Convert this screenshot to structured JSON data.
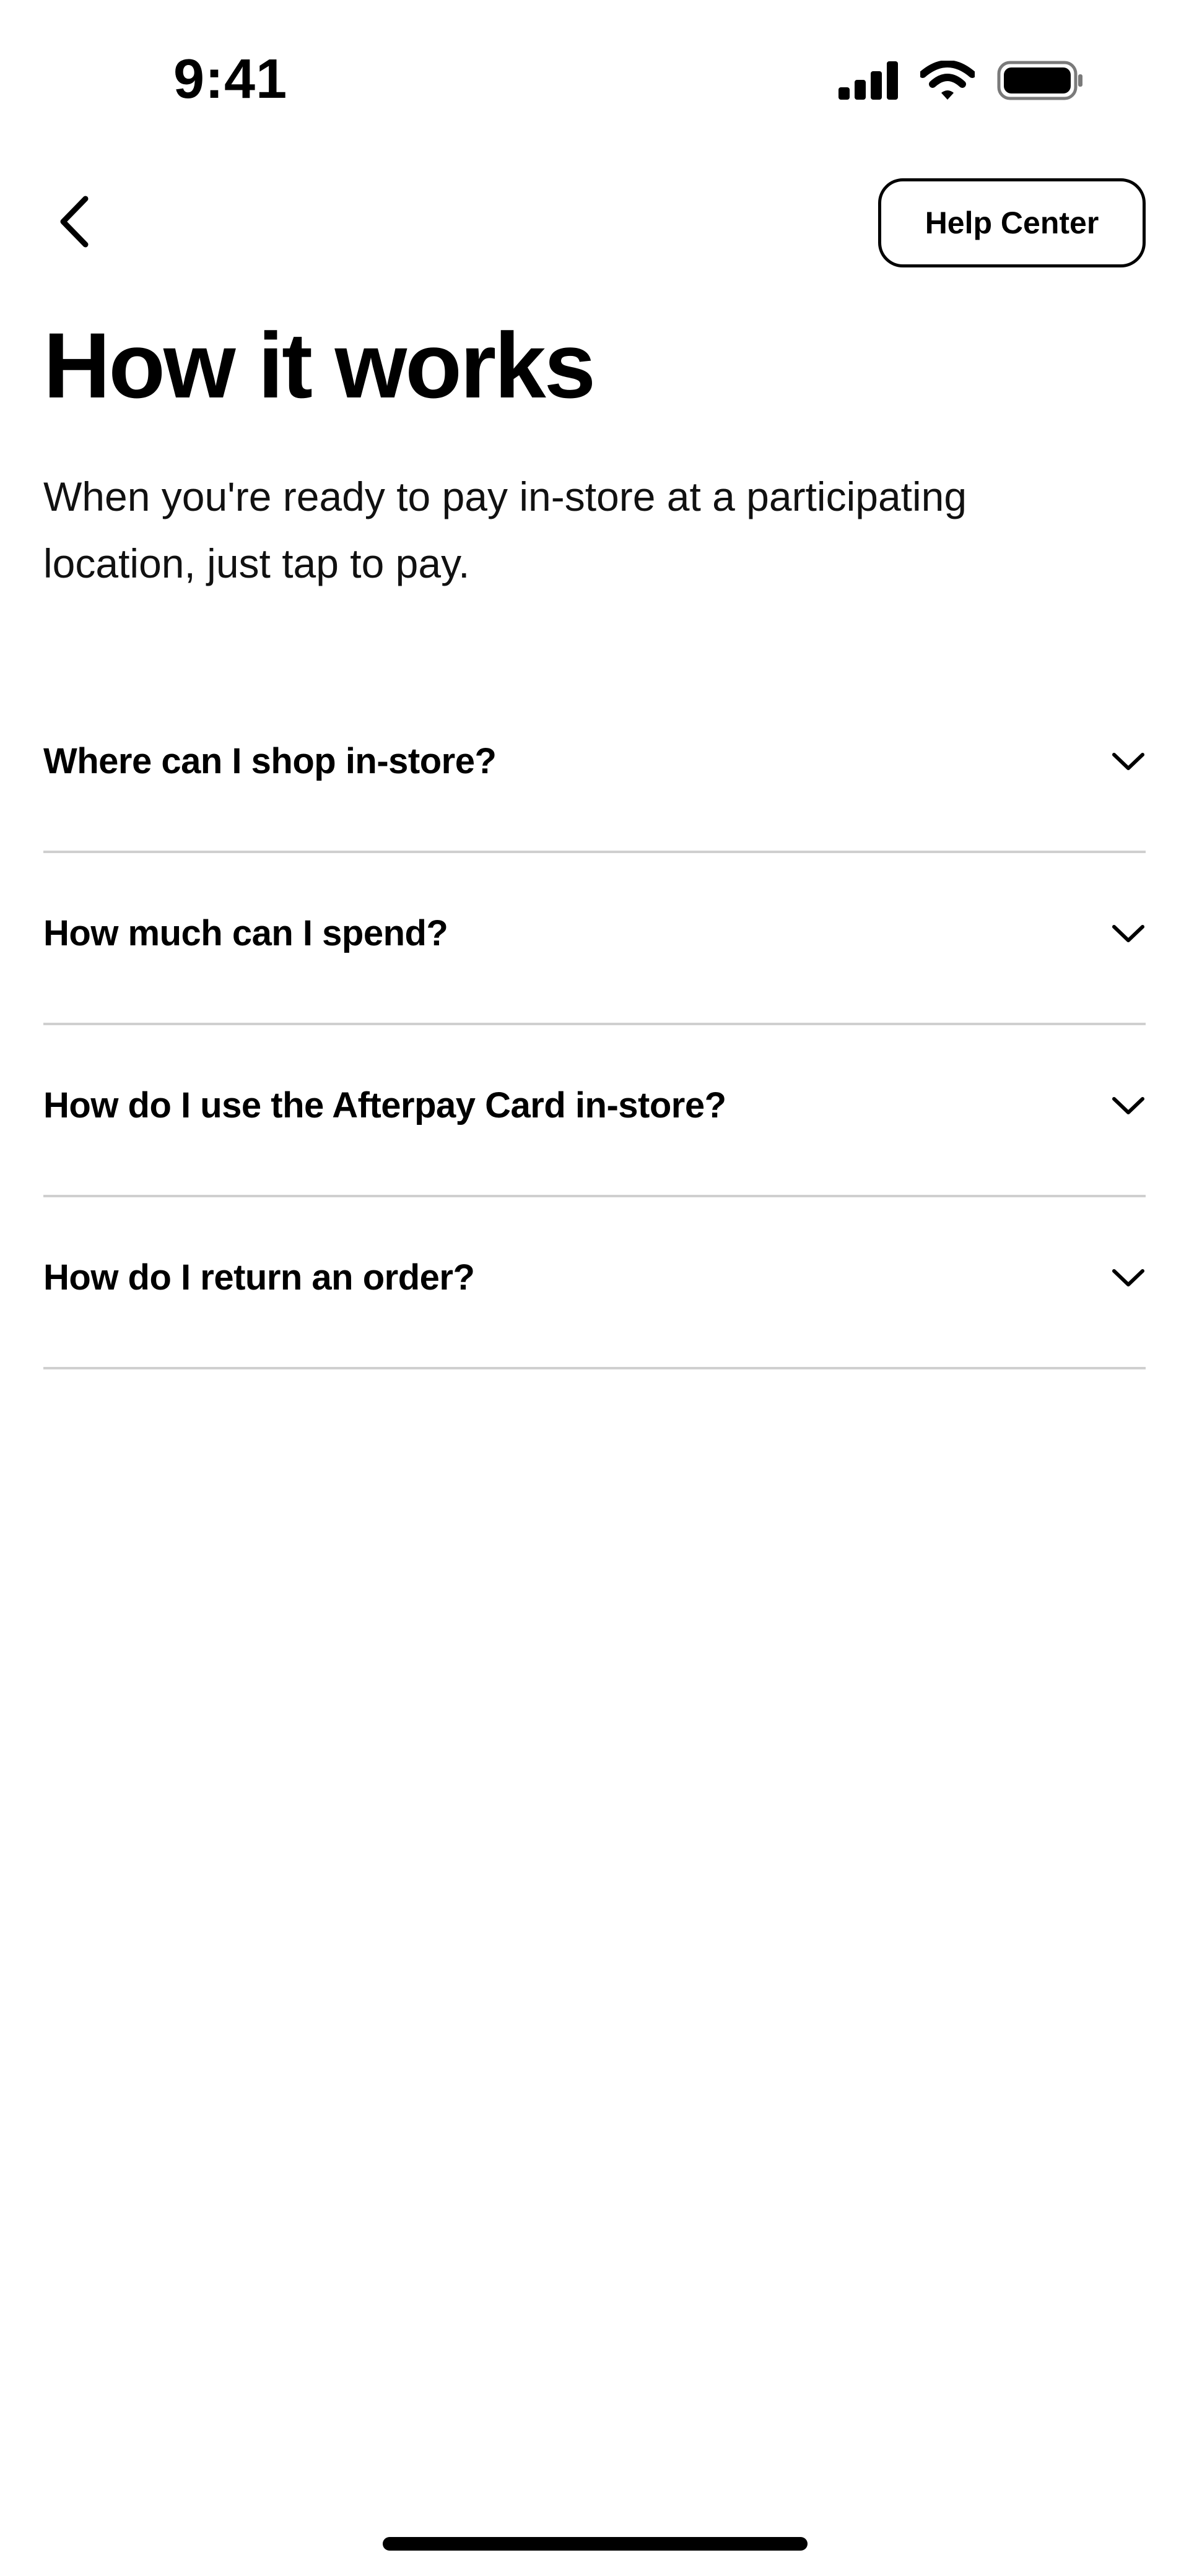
{
  "status_bar": {
    "time": "9:41",
    "icons": [
      "cellular-signal-icon",
      "wifi-icon",
      "battery-icon"
    ]
  },
  "nav": {
    "back_icon": "chevron-left-icon",
    "help_label": "Help Center"
  },
  "main": {
    "title": "How it works",
    "description": "When you're ready to pay in-store at a participating location, just tap to pay."
  },
  "faq": {
    "items": [
      {
        "question": "Where can I shop in-store?",
        "expanded": false
      },
      {
        "question": "How much can I spend?",
        "expanded": false
      },
      {
        "question": "How do I use the Afterpay Card in-store?",
        "expanded": false
      },
      {
        "question": "How do I return an order?",
        "expanded": false
      }
    ],
    "chevron_icon": "chevron-down-icon"
  },
  "colors": {
    "background": "#ffffff",
    "text": "#000000",
    "divider": "#cfcfcf"
  }
}
